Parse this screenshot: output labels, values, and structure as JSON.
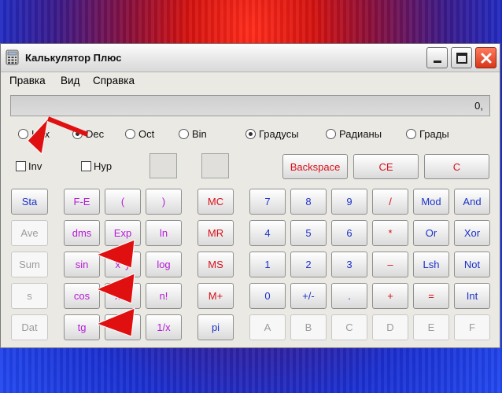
{
  "colors": {
    "blue": "#1c33c9",
    "red": "#d8101a",
    "magenta": "#b51bd6",
    "gray": "#9c9c9c",
    "arrow": "#e11010"
  },
  "window": {
    "title": "Калькулятор Плюс",
    "minimize_icon": "minimize-icon",
    "maximize_icon": "maximize-icon",
    "close_icon": "close-icon"
  },
  "menu": [
    "Правка",
    "Вид",
    "Справка"
  ],
  "display": {
    "value": "0,"
  },
  "number_system": {
    "options": [
      "Hex",
      "Dec",
      "Oct",
      "Bin"
    ],
    "selected": "Dec"
  },
  "angle_units": {
    "options": [
      "Градусы",
      "Радианы",
      "Грады"
    ],
    "selected": "Градусы"
  },
  "checkboxes": {
    "inv": "Inv",
    "hyp": "Hyp"
  },
  "top_buttons": [
    "Backspace",
    "CE",
    "C"
  ],
  "stats_buttons": [
    {
      "label": "Sta",
      "enabled": true
    },
    {
      "label": "Ave",
      "enabled": false
    },
    {
      "label": "Sum",
      "enabled": false
    },
    {
      "label": "s",
      "enabled": false
    },
    {
      "label": "Dat",
      "enabled": false
    }
  ],
  "sci_buttons": [
    [
      "F-E",
      "(",
      ")"
    ],
    [
      "dms",
      "Exp",
      "ln"
    ],
    [
      "sin",
      "x^y",
      "log"
    ],
    [
      "cos",
      "x^3",
      "n!"
    ],
    [
      "tg",
      "x^2",
      "1/x"
    ]
  ],
  "memory_buttons": [
    "MC",
    "MR",
    "MS",
    "M+",
    "pi"
  ],
  "digit_pad": [
    [
      "7",
      "8",
      "9",
      "/",
      "Mod",
      "And"
    ],
    [
      "4",
      "5",
      "6",
      "*",
      "Or",
      "Xor"
    ],
    [
      "1",
      "2",
      "3",
      "–",
      "Lsh",
      "Not"
    ],
    [
      "0",
      "+/-",
      ".",
      "+",
      "=",
      "Int"
    ],
    [
      "A",
      "B",
      "C",
      "D",
      "E",
      "F"
    ]
  ]
}
